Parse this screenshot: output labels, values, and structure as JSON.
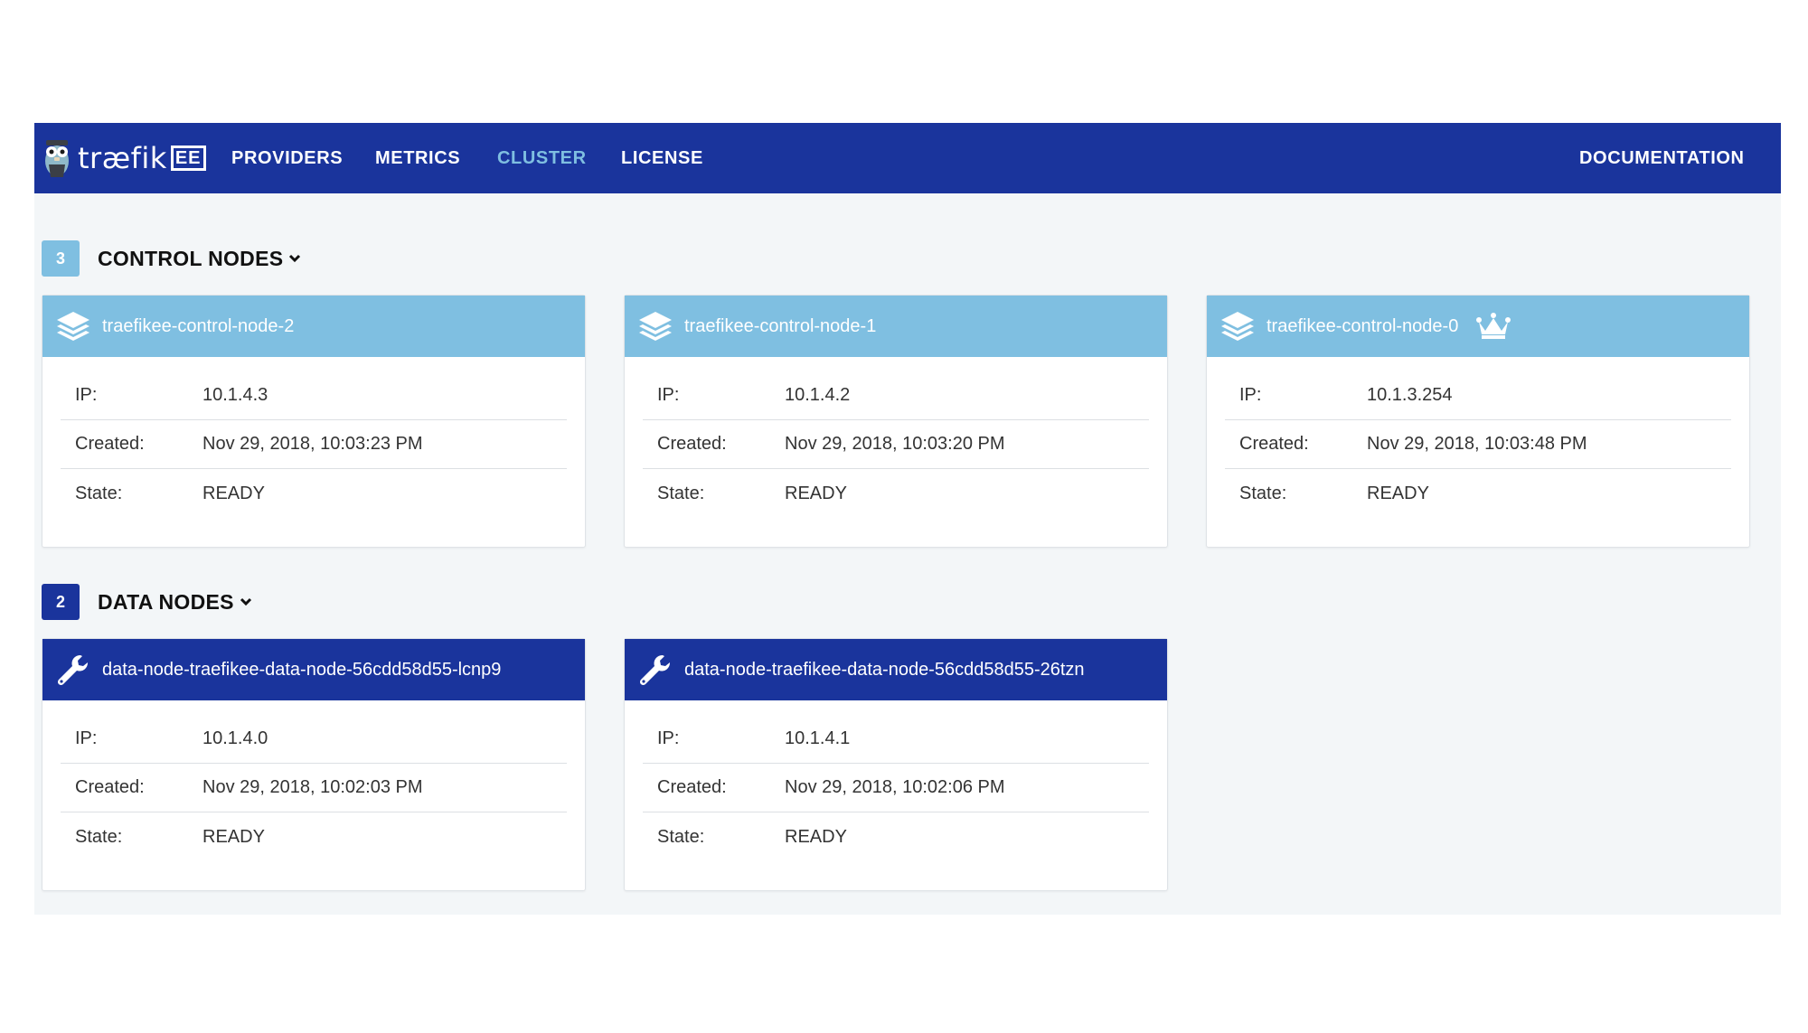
{
  "navbar": {
    "logo_text": "træfik",
    "logo_badge": "EE",
    "links": [
      {
        "label": "PROVIDERS"
      },
      {
        "label": "METRICS"
      },
      {
        "label": "CLUSTER"
      },
      {
        "label": "LICENSE"
      }
    ],
    "active": "CLUSTER",
    "documentation_label": "DOCUMENTATION"
  },
  "colors": {
    "primary": "#1a349c",
    "accent": "#7fbfe1",
    "background": "#f3f6f8"
  },
  "sections": {
    "control": {
      "count": "3",
      "title": "CONTROL NODES",
      "icon": "layers-icon",
      "nodes": [
        {
          "name": "traefikee-control-node-2",
          "ip": "10.1.4.3",
          "created": "Nov 29, 2018, 10:03:23 PM",
          "state": "READY",
          "leader": false
        },
        {
          "name": "traefikee-control-node-1",
          "ip": "10.1.4.2",
          "created": "Nov 29, 2018, 10:03:20 PM",
          "state": "READY",
          "leader": false
        },
        {
          "name": "traefikee-control-node-0",
          "ip": "10.1.3.254",
          "created": "Nov 29, 2018, 10:03:48 PM",
          "state": "READY",
          "leader": true
        }
      ]
    },
    "data": {
      "count": "2",
      "title": "DATA NODES",
      "icon": "wrench-icon",
      "nodes": [
        {
          "name": "data-node-traefikee-data-node-56cdd58d55-lcnp9",
          "ip": "10.1.4.0",
          "created": "Nov 29, 2018, 10:02:03 PM",
          "state": "READY"
        },
        {
          "name": "data-node-traefikee-data-node-56cdd58d55-26tzn",
          "ip": "10.1.4.1",
          "created": "Nov 29, 2018, 10:02:06 PM",
          "state": "READY"
        }
      ]
    }
  },
  "labels": {
    "ip": "IP:",
    "created": "Created:",
    "state": "State:"
  }
}
